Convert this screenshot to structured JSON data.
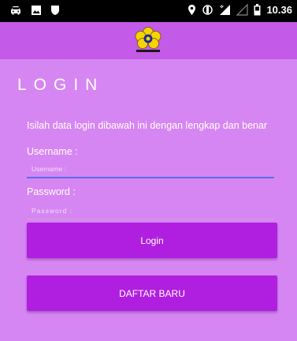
{
  "status_bar": {
    "time": "10.36",
    "icons": [
      "car-icon",
      "image-icon",
      "shield-icon",
      "location-icon",
      "vibrate-icon",
      "signal-icon",
      "signal-empty-icon",
      "battery-icon"
    ]
  },
  "login": {
    "title": "LOGIN",
    "instructions": "Isilah data login dibawah ini dengan lengkap dan benar",
    "username_label": "Username :",
    "username_placeholder": "Username :",
    "password_label": "Password :",
    "password_placeholder": "Password :",
    "login_button": "Login",
    "register_button": "DAFTAR BARU"
  },
  "colors": {
    "background": "#d686f2",
    "app_bar": "#c45ae8",
    "button": "#b01fe0",
    "status_bar": "#000000",
    "input_focus_line": "#5b6fe8"
  }
}
